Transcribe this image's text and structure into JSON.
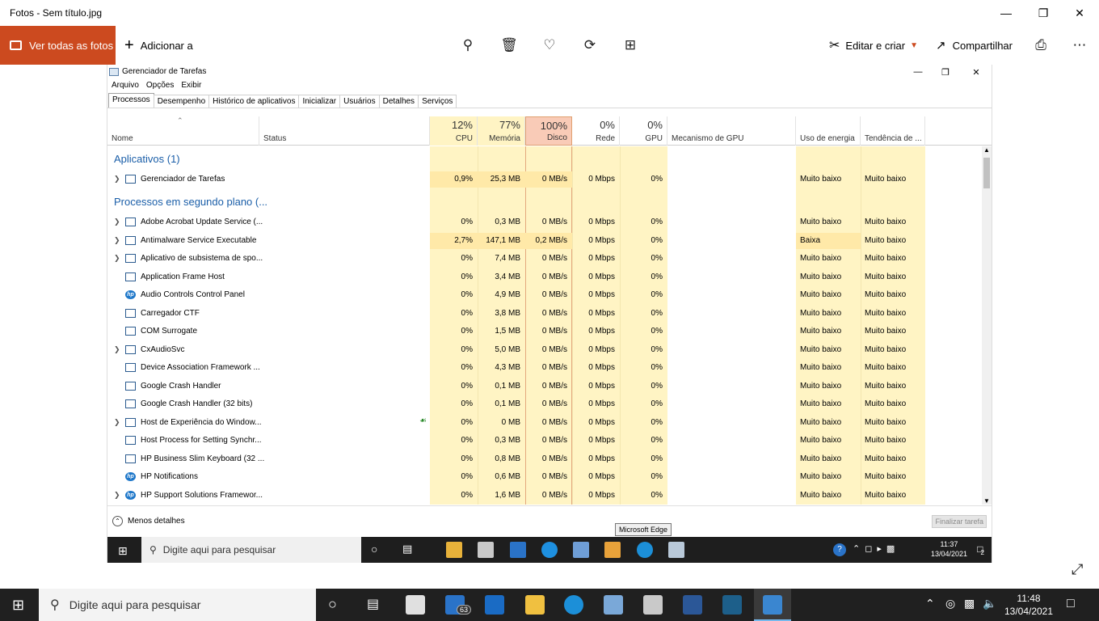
{
  "app": {
    "title": "Fotos - Sem título.jpg"
  },
  "toolbar": {
    "see_all": "Ver todas as fotos",
    "add_to": "Adicionar a",
    "edit_create": "Editar e criar",
    "share": "Compartilhar"
  },
  "tm": {
    "title": "Gerenciador de Tarefas",
    "menu": [
      "Arquivo",
      "Opções",
      "Exibir"
    ],
    "tabs": [
      "Processos",
      "Desempenho",
      "Histórico de aplicativos",
      "Inicializar",
      "Usuários",
      "Detalhes",
      "Serviços"
    ],
    "headers": {
      "name": "Nome",
      "status": "Status",
      "cpu_pct": "12%",
      "cpu": "CPU",
      "mem_pct": "77%",
      "mem": "Memória",
      "disk_pct": "100%",
      "disk": "Disco",
      "net_pct": "0%",
      "net": "Rede",
      "gpu_pct": "0%",
      "gpu": "GPU",
      "gpu_engine": "Mecanismo de GPU",
      "power": "Uso de energia",
      "power_trend": "Tendência de ..."
    },
    "groups": {
      "apps": "Aplicativos (1)",
      "background": "Processos em segundo plano (..."
    },
    "app_rows": [
      {
        "name": "Gerenciador de Tarefas",
        "cpu": "0,9%",
        "mem": "25,3 MB",
        "disk": "0 MB/s",
        "net": "0 Mbps",
        "gpu": "0%",
        "power": "Muito baixo",
        "trend": "Muito baixo"
      }
    ],
    "bg_rows": [
      {
        "name": "Adobe Acrobat Update Service (...",
        "cpu": "0%",
        "mem": "0,3 MB",
        "disk": "0 MB/s",
        "net": "0 Mbps",
        "gpu": "0%",
        "power": "Muito baixo",
        "trend": "Muito baixo"
      },
      {
        "name": "Antimalware Service Executable",
        "cpu": "2,7%",
        "mem": "147,1 MB",
        "disk": "0,2 MB/s",
        "net": "0 Mbps",
        "gpu": "0%",
        "power": "Baixa",
        "trend": "Muito baixo"
      },
      {
        "name": "Aplicativo de subsistema de spo...",
        "cpu": "0%",
        "mem": "7,4 MB",
        "disk": "0 MB/s",
        "net": "0 Mbps",
        "gpu": "0%",
        "power": "Muito baixo",
        "trend": "Muito baixo"
      },
      {
        "name": "Application Frame Host",
        "cpu": "0%",
        "mem": "3,4 MB",
        "disk": "0 MB/s",
        "net": "0 Mbps",
        "gpu": "0%",
        "power": "Muito baixo",
        "trend": "Muito baixo"
      },
      {
        "name": "Audio Controls Control Panel",
        "cpu": "0%",
        "mem": "4,9 MB",
        "disk": "0 MB/s",
        "net": "0 Mbps",
        "gpu": "0%",
        "power": "Muito baixo",
        "trend": "Muito baixo"
      },
      {
        "name": "Carregador CTF",
        "cpu": "0%",
        "mem": "3,8 MB",
        "disk": "0 MB/s",
        "net": "0 Mbps",
        "gpu": "0%",
        "power": "Muito baixo",
        "trend": "Muito baixo"
      },
      {
        "name": "COM Surrogate",
        "cpu": "0%",
        "mem": "1,5 MB",
        "disk": "0 MB/s",
        "net": "0 Mbps",
        "gpu": "0%",
        "power": "Muito baixo",
        "trend": "Muito baixo"
      },
      {
        "name": "CxAudioSvc",
        "cpu": "0%",
        "mem": "5,0 MB",
        "disk": "0 MB/s",
        "net": "0 Mbps",
        "gpu": "0%",
        "power": "Muito baixo",
        "trend": "Muito baixo"
      },
      {
        "name": "Device Association Framework ...",
        "cpu": "0%",
        "mem": "4,3 MB",
        "disk": "0 MB/s",
        "net": "0 Mbps",
        "gpu": "0%",
        "power": "Muito baixo",
        "trend": "Muito baixo"
      },
      {
        "name": "Google Crash Handler",
        "cpu": "0%",
        "mem": "0,1 MB",
        "disk": "0 MB/s",
        "net": "0 Mbps",
        "gpu": "0%",
        "power": "Muito baixo",
        "trend": "Muito baixo"
      },
      {
        "name": "Google Crash Handler (32 bits)",
        "cpu": "0%",
        "mem": "0,1 MB",
        "disk": "0 MB/s",
        "net": "0 Mbps",
        "gpu": "0%",
        "power": "Muito baixo",
        "trend": "Muito baixo"
      },
      {
        "name": "Host de Experiência do Window...",
        "cpu": "0%",
        "mem": "0 MB",
        "disk": "0 MB/s",
        "net": "0 Mbps",
        "gpu": "0%",
        "power": "Muito baixo",
        "trend": "Muito baixo"
      },
      {
        "name": "Host Process for Setting Synchr...",
        "cpu": "0%",
        "mem": "0,3 MB",
        "disk": "0 MB/s",
        "net": "0 Mbps",
        "gpu": "0%",
        "power": "Muito baixo",
        "trend": "Muito baixo"
      },
      {
        "name": "HP Business Slim Keyboard (32 ...",
        "cpu": "0%",
        "mem": "0,8 MB",
        "disk": "0 MB/s",
        "net": "0 Mbps",
        "gpu": "0%",
        "power": "Muito baixo",
        "trend": "Muito baixo"
      },
      {
        "name": "HP Notifications",
        "cpu": "0%",
        "mem": "0,6 MB",
        "disk": "0 MB/s",
        "net": "0 Mbps",
        "gpu": "0%",
        "power": "Muito baixo",
        "trend": "Muito baixo"
      },
      {
        "name": "HP Support Solutions Framewor...",
        "cpu": "0%",
        "mem": "1,6 MB",
        "disk": "0 MB/s",
        "net": "0 Mbps",
        "gpu": "0%",
        "power": "Muito baixo",
        "trend": "Muito baixo"
      }
    ],
    "less_details": "Menos detalhes",
    "end_task": "Finalizar tarefa",
    "tooltip": "Microsoft Edge",
    "taskbar": {
      "search": "Digite aqui para pesquisar",
      "time": "11:37",
      "date": "13/04/2021",
      "notif": "2"
    }
  },
  "taskbar": {
    "search": "Digite aqui para pesquisar",
    "time": "11:48",
    "date": "13/04/2021",
    "mail_badge": "63"
  }
}
